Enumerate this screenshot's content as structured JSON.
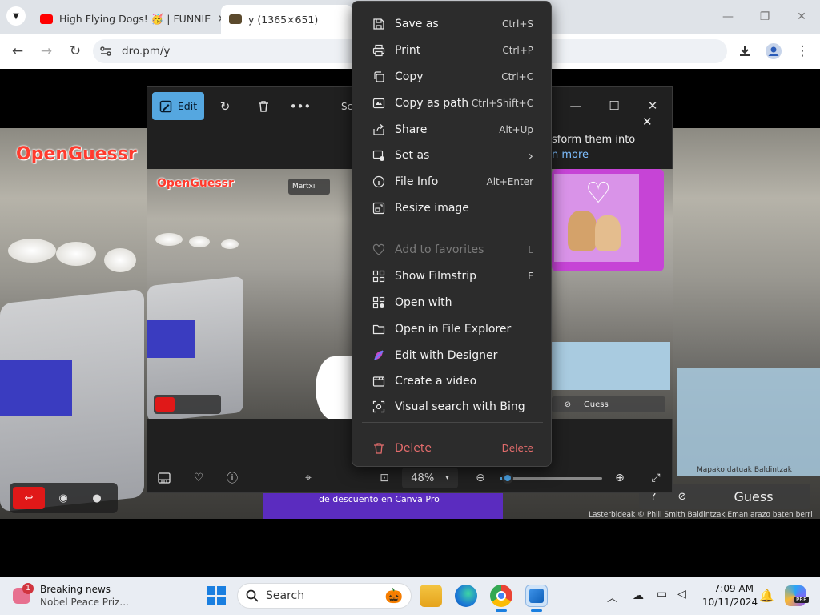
{
  "browser": {
    "tabs": [
      {
        "label": "High Flying Dogs! 🥳 | FUNNIE",
        "active": false
      },
      {
        "label": "y (1365×651)",
        "active": true
      }
    ],
    "url": "dro.pm/y"
  },
  "page_content": {
    "logo_text": "OpenGuessr",
    "guess_label": "Guess",
    "attribution": "Lasterbideak  © Phili Smith  Baldintzak  Eman arazo baten berri",
    "map_attribution": "Mapako datuak  Baldintzak",
    "promo_text": "de descuento en Canva Pro",
    "snippet_text": "sform them into",
    "snippet_link": "n more",
    "user_chip": "Martxi"
  },
  "photos_app": {
    "edit_label": "Edit",
    "toolbar_partial": "Sc",
    "zoom_level": "48%",
    "zoom_fraction": 0.05
  },
  "context_menu": {
    "items": [
      {
        "label": "Save as",
        "shortcut": "Ctrl+S",
        "icon": "save-as-icon"
      },
      {
        "label": "Print",
        "shortcut": "Ctrl+P",
        "icon": "printer-icon"
      },
      {
        "label": "Copy",
        "shortcut": "Ctrl+C",
        "icon": "copy-icon"
      },
      {
        "label": "Copy as path",
        "shortcut": "Ctrl+Shift+C",
        "icon": "copy-path-icon"
      },
      {
        "label": "Share",
        "shortcut": "Alt+Up",
        "icon": "share-icon"
      },
      {
        "label": "Set as",
        "shortcut": "›",
        "icon": "set-as-icon"
      },
      {
        "label": "File Info",
        "shortcut": "Alt+Enter",
        "icon": "info-icon"
      },
      {
        "label": "Resize image",
        "shortcut": "",
        "icon": "resize-icon"
      },
      {
        "label": "Add to favorites",
        "shortcut": "L",
        "icon": "heart-icon",
        "disabled": true
      },
      {
        "label": "Show Filmstrip",
        "shortcut": "F",
        "icon": "filmstrip-icon"
      },
      {
        "label": "Open with",
        "shortcut": "",
        "icon": "open-with-icon"
      },
      {
        "label": "Open in File Explorer",
        "shortcut": "",
        "icon": "folder-icon"
      },
      {
        "label": "Edit with Designer",
        "shortcut": "",
        "icon": "designer-icon"
      },
      {
        "label": "Create a video",
        "shortcut": "",
        "icon": "video-icon"
      },
      {
        "label": "Visual search with Bing",
        "shortcut": "",
        "icon": "visual-search-icon"
      },
      {
        "label": "Delete",
        "shortcut": "Delete",
        "icon": "trash-icon",
        "danger": true
      }
    ]
  },
  "taskbar": {
    "news_title": "Breaking news",
    "news_sub": "Nobel Peace Priz...",
    "news_badge": "1",
    "search_label": "Search",
    "time": "7:09 AM",
    "date": "10/11/2024",
    "copilot_badge": "PRE"
  },
  "colors": {
    "accent": "#55a7e0",
    "menu_bg": "#2c2c2c",
    "danger": "#e36c6c",
    "logo": "#ff3b2e"
  }
}
